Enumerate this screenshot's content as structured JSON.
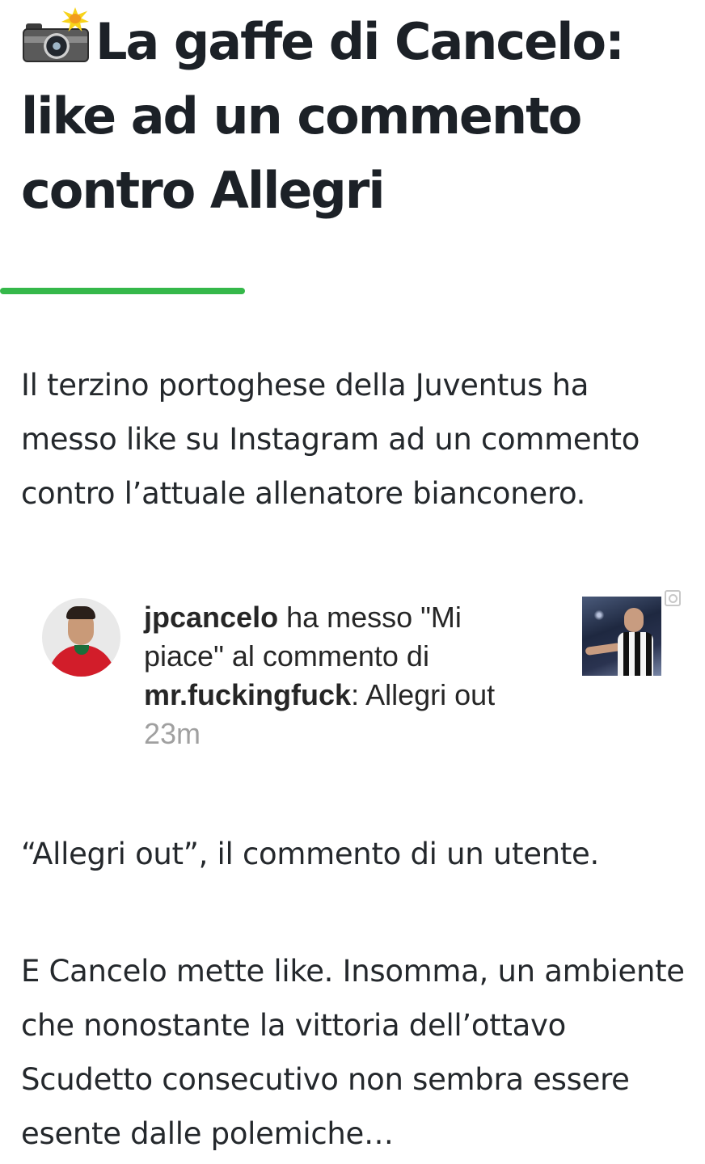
{
  "article": {
    "title_icon": "camera-flash-icon",
    "title": "La gaffe di Cancelo: like ad un commento contro Allegri",
    "accent_color": "#35b84a",
    "intro": "Il terzino portoghese della Juventus ha messo like su Instagram ad un commento contro l’attuale allenatore bianconero.",
    "paragraph_2": "“Allegri out”, il commento di un utente.",
    "paragraph_3": "E Cancelo mette like. Insomma, un ambiente che nonostante la vittoria dell’ottavo Scudetto consecutivo non sembra essere esente dalle polemiche…"
  },
  "instagram_notification": {
    "username": "jpcancelo",
    "action_text": " ha messo \"Mi piace\" al commento di ",
    "commenter": "mr.fuckingfuck",
    "comment": ": Allegri out",
    "time": "23m",
    "avatar_icon": "profile-avatar",
    "thumbnail_icon": "post-thumbnail",
    "expand_icon": "zoom-icon"
  }
}
